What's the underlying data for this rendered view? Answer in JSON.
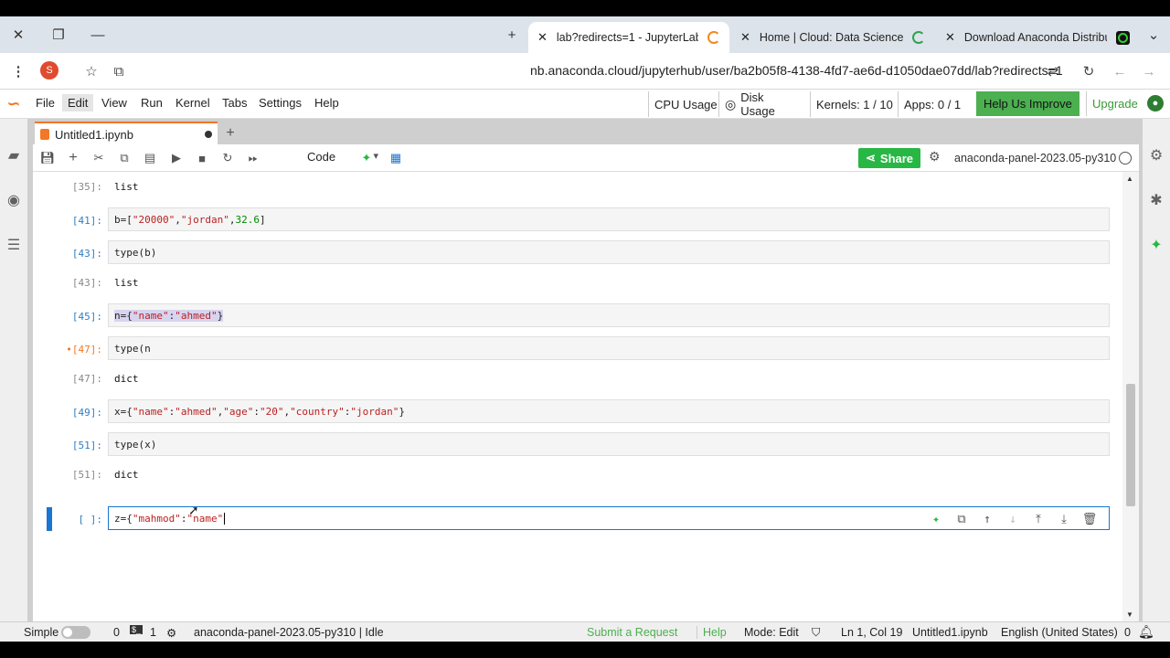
{
  "browser": {
    "tabs": [
      {
        "title": "lab?redirects=1 - JupyterLab",
        "active": true
      },
      {
        "title": "Home | Cloud: Data Science and",
        "active": false
      },
      {
        "title": "Download Anaconda Distributio",
        "active": false
      }
    ],
    "profile_initial": "S",
    "url": "nb.anaconda.cloud/jupyterhub/user/ba2b05f8-4138-4fd7-ae6d-d1050dae07dd/lab?redirects=1"
  },
  "menu": {
    "items": [
      "File",
      "Edit",
      "View",
      "Run",
      "Kernel",
      "Tabs",
      "Settings",
      "Help"
    ],
    "cpu": "CPU Usage",
    "disk": "Disk Usage",
    "kernels": "Kernels: 1 / 10",
    "apps": "Apps: 0 / 1",
    "help_improve": "Help Us Improve",
    "upgrade": "Upgrade"
  },
  "notebook": {
    "tab_title": "Untitled1.ipynb",
    "cell_type": "Code",
    "share": "Share",
    "kernel_name": "anaconda-panel-2023.05-py310"
  },
  "cells": {
    "out35_prompt": "[35]:",
    "out35_text": "list",
    "in41_prompt": "[41]:",
    "in41_a": "b=[",
    "in41_b": "\"20000\"",
    "in41_c": ",",
    "in41_d": "\"jordan\"",
    "in41_e": ",",
    "in41_f": "32.6",
    "in41_g": "]",
    "in43_prompt": "[43]:",
    "in43_text": "type(b)",
    "out43_prompt": "[43]:",
    "out43_text": "list",
    "in45_prompt": "[45]:",
    "in45_a": "n={",
    "in45_b": "\"name\"",
    "in45_c": ":",
    "in45_d": "\"ahmed\"",
    "in45_e": "}",
    "in47_prompt": "•[47]:",
    "in47_text": "type(n",
    "out47_prompt": "[47]:",
    "out47_text": "dict",
    "in49_prompt": "[49]:",
    "in49_a": "x={",
    "in49_b": "\"name\"",
    "in49_c": ":",
    "in49_d": "\"ahmed\"",
    "in49_e": ",",
    "in49_f": "\"age\"",
    "in49_g": ":",
    "in49_h": "\"20\"",
    "in49_i": ",",
    "in49_j": "\"country\"",
    "in49_k": ":",
    "in49_l": "\"jordan\"",
    "in49_m": "}",
    "in51_prompt": "[51]:",
    "in51_text": "type(x)",
    "out51_prompt": "[51]:",
    "out51_text": "dict",
    "active_prompt": "[ ]:",
    "active_a": "z={",
    "active_b": "\"mahmod\"",
    "active_c": ":",
    "active_d": "\"name\""
  },
  "status": {
    "mode_label": "Simple",
    "zero": "0",
    "one": "1",
    "kernel_status": "anaconda-panel-2023.05-py310 | Idle",
    "submit": "Submit a Request",
    "help": "Help",
    "mode": "Mode: Edit",
    "position": "Ln 1, Col 19",
    "file": "Untitled1.ipynb",
    "language": "English (United States)",
    "notif_count": "0"
  },
  "colors": {
    "accent": "#1976d2",
    "jupyter_orange": "#f37726",
    "share_green": "#28b745",
    "help_green": "#4caf50"
  }
}
